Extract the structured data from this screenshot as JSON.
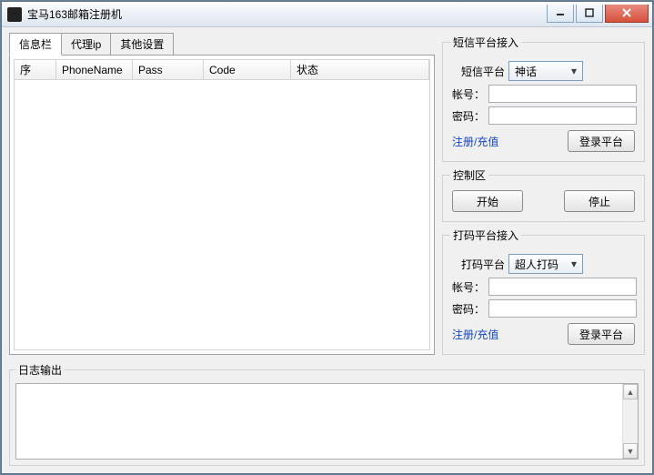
{
  "window": {
    "title": "宝马163邮箱注册机"
  },
  "tabs": [
    {
      "label": "信息栏",
      "active": true
    },
    {
      "label": "代理ip",
      "active": false
    },
    {
      "label": "其他设置",
      "active": false
    }
  ],
  "list_columns": [
    "序",
    "PhoneName",
    "Pass",
    "Code",
    "状态"
  ],
  "sms_panel": {
    "legend": "短信平台接入",
    "platform_label": "短信平台",
    "platform_value": "神话",
    "account_label": "帐号：",
    "password_label": "密码：",
    "link": "注册/充值",
    "login": "登录平台"
  },
  "control_panel": {
    "legend": "控制区",
    "start": "开始",
    "stop": "停止"
  },
  "captcha_panel": {
    "legend": "打码平台接入",
    "platform_label": "打码平台",
    "platform_value": "超人打码",
    "account_label": "帐号：",
    "password_label": "密码：",
    "link": "注册/充值",
    "login": "登录平台"
  },
  "log": {
    "legend": "日志输出"
  }
}
